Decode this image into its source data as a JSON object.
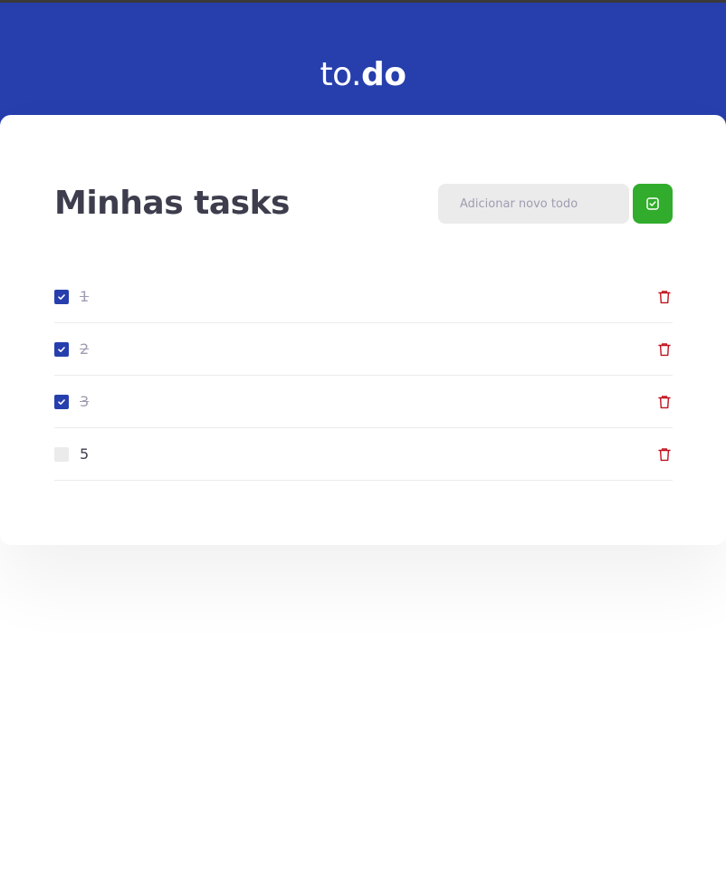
{
  "app": {
    "brand_prefix": "to.",
    "brand_suffix": "do"
  },
  "main": {
    "title": "Minhas tasks",
    "new_task_placeholder": "Adicionar novo todo"
  },
  "tasks": [
    {
      "label": "1",
      "done": true
    },
    {
      "label": "2",
      "done": true
    },
    {
      "label": "3",
      "done": true
    },
    {
      "label": "5",
      "done": false
    }
  ],
  "icons": {
    "add": "check-square-icon",
    "check": "check-icon",
    "delete": "trash-icon"
  },
  "colors": {
    "header": "#273fad",
    "add_button": "#31ac2c",
    "checkbox_checked": "#273fad",
    "checkbox_unchecked": "#ebebeb",
    "trash": "#c1121f",
    "title": "#3d3d4d",
    "done_text": "#a09cb1"
  }
}
